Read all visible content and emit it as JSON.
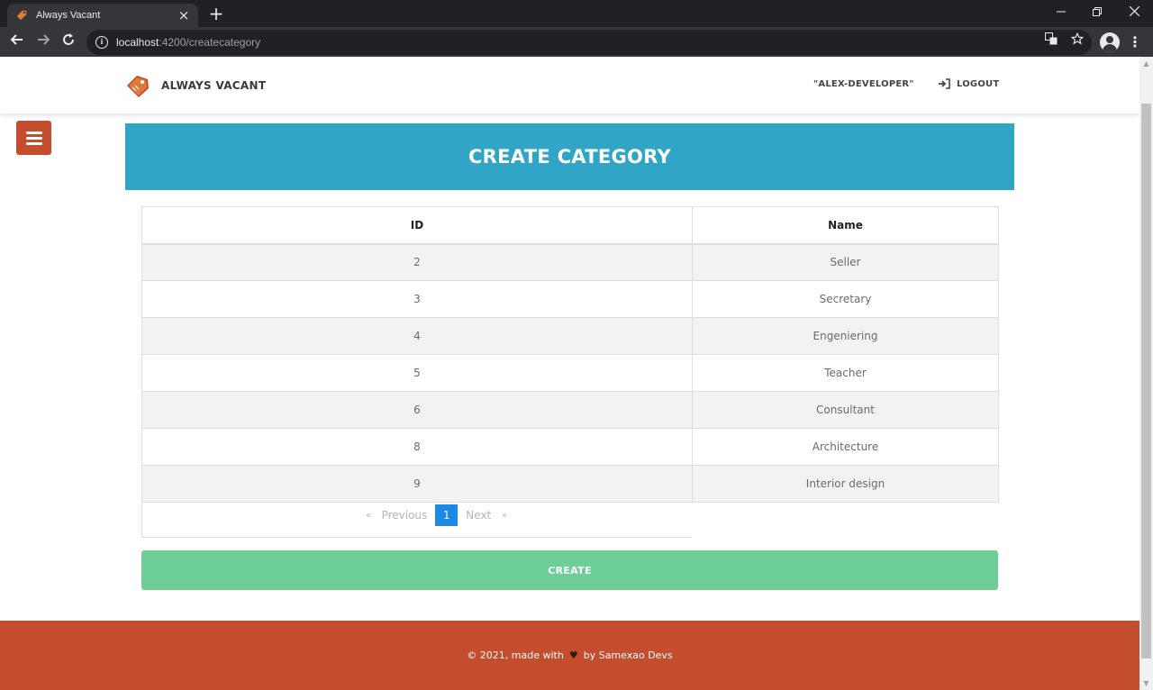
{
  "browser": {
    "tab_title": "Always Vacant",
    "url_host": "localhost",
    "url_rest": ":4200/createcategory",
    "new_tab_symbol": "+",
    "tab_close_symbol": "×"
  },
  "header": {
    "brand_name": "ALWAYS VACANT",
    "user_name": "\"ALEX-DEVELOPER\"",
    "logout_label": "LOGOUT"
  },
  "banner": {
    "title": "CREATE CATEGORY"
  },
  "table": {
    "columns": [
      "ID",
      "Name"
    ],
    "rows": [
      {
        "id": "2",
        "name": "Seller"
      },
      {
        "id": "3",
        "name": "Secretary"
      },
      {
        "id": "4",
        "name": "Engeniering"
      },
      {
        "id": "5",
        "name": "Teacher"
      },
      {
        "id": "6",
        "name": "Consultant"
      },
      {
        "id": "8",
        "name": "Architecture"
      },
      {
        "id": "9",
        "name": "Interior design"
      }
    ]
  },
  "pagination": {
    "prev_label": "Previous",
    "next_label": "Next",
    "current_page": "1"
  },
  "create_button": {
    "label": "CREATE"
  },
  "footer": {
    "text_before": "© 2021, made with",
    "text_after": "by Samexao Devs"
  },
  "colors": {
    "banner": "#31a5c6",
    "accent_red": "#c44d2d",
    "create_green": "#6dcf96",
    "page_active": "#1e88e5"
  },
  "icons": [
    "tag-icon",
    "info-icon",
    "translate-icon",
    "star-icon",
    "profile-icon",
    "menu-icon",
    "logout-icon",
    "heart-icon"
  ]
}
